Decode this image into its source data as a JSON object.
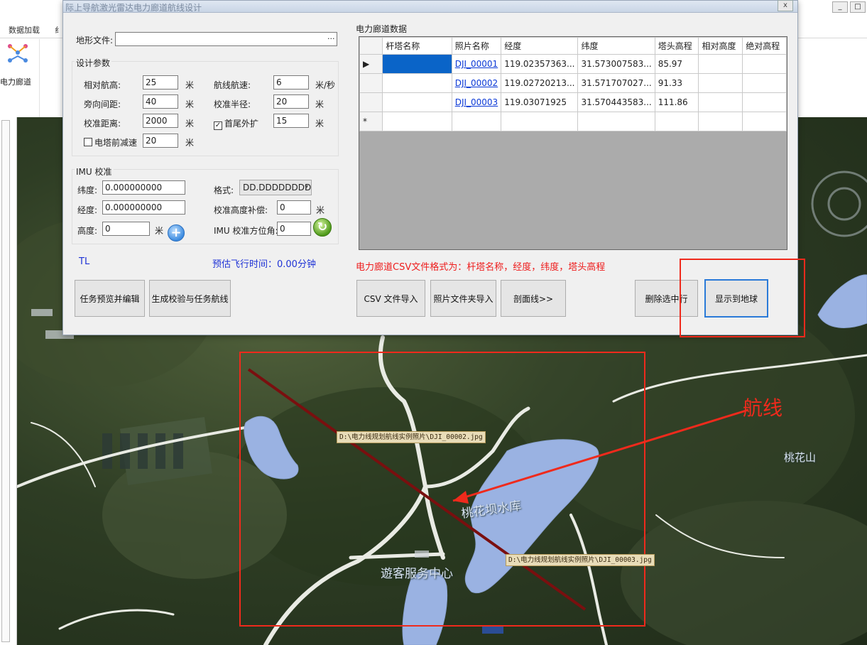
{
  "host": {
    "ribbon_tabs": [
      "数据加载",
      "纟"
    ],
    "group_label": "电力廊道",
    "window_controls": [
      "_",
      "□"
    ]
  },
  "dialog": {
    "title": "际上导航激光雷达电力廊道航线设计",
    "close_label": "x",
    "terrain_label": "地形文件:",
    "terrain_value": "",
    "browse_label": "...",
    "design_params": {
      "title": "设计参数",
      "rel_alt_label": "相对航高:",
      "rel_alt": "25",
      "rel_alt_unit": "米",
      "side_spacing_label": "旁向间距:",
      "side_spacing": "40",
      "side_spacing_unit": "米",
      "calib_dist_label": "校准距离:",
      "calib_dist": "2000",
      "calib_dist_unit": "米",
      "tower_decel_label": "电塔前减速",
      "tower_decel": "20",
      "tower_decel_unit": "米",
      "speed_label": "航线航速:",
      "speed": "6",
      "speed_unit": "米/秒",
      "calib_radius_label": "校准半径:",
      "calib_radius": "20",
      "calib_radius_unit": "米",
      "ends_extend_label": "首尾外扩",
      "ends_extend": "15",
      "ends_extend_unit": "米"
    },
    "imu": {
      "title": "IMU 校准",
      "lat_label": "纬度:",
      "lat": "0.000000000",
      "lon_label": "经度:",
      "lon": "0.000000000",
      "height_label": "高度:",
      "height": "0",
      "height_unit": "米",
      "format_label": "格式:",
      "format": "DD.DDDDDDDD",
      "calib_height_label": "校准高度补偿:",
      "calib_height": "0",
      "calib_height_unit": "米",
      "azimuth_label": "IMU 校准方位角:",
      "azimuth": "0",
      "add_glyph": "+",
      "refresh_glyph": "↻"
    },
    "tl_label": "TL",
    "flight_time_label": "预估飞行时间：0.00分钟",
    "btn_preview": "任务预览并编辑",
    "btn_generate": "生成校验与任务航线",
    "corridor": {
      "title": "电力廊道数据",
      "columns": [
        "杆塔名称",
        "照片名称",
        "经度",
        "纬度",
        "塔头高程",
        "相对高度",
        "绝对高程"
      ],
      "rows": [
        {
          "marker": "▶",
          "name": "",
          "photo": "DJI_00001",
          "lon": "119.02357363...",
          "lat": "31.573007583...",
          "elev": "85.97",
          "rel": "",
          "abs": ""
        },
        {
          "marker": "",
          "name": "",
          "photo": "DJI_00002",
          "lon": "119.02720213...",
          "lat": "31.571707027...",
          "elev": "91.33",
          "rel": "",
          "abs": ""
        },
        {
          "marker": "",
          "name": "",
          "photo": "DJI_00003",
          "lon": "119.03071925",
          "lat": "31.570443583...",
          "elev": "111.86",
          "rel": "",
          "abs": ""
        },
        {
          "marker": "*",
          "name": "",
          "photo": "",
          "lon": "",
          "lat": "",
          "elev": "",
          "rel": "",
          "abs": ""
        }
      ],
      "csv_note": "电力廊道CSV文件格式为：杆塔名称，经度，纬度，塔头高程",
      "btn_csv": "CSV 文件导入",
      "btn_photo": "照片文件夹导入",
      "btn_profile": "剖面线>>",
      "btn_delete": "删除选中行",
      "btn_show": "显示到地球"
    }
  },
  "map": {
    "label_photo2": "D:\\电力线规划航线实例照片\\DJI_00002.jpg",
    "label_photo3": "D:\\电力线规划航线实例照片\\DJI_00003.jpg",
    "reservoir": "桃花坝水库",
    "visitor_center": "遊客服务中心",
    "mountain": "桃花山",
    "route_annotation": "航线"
  }
}
